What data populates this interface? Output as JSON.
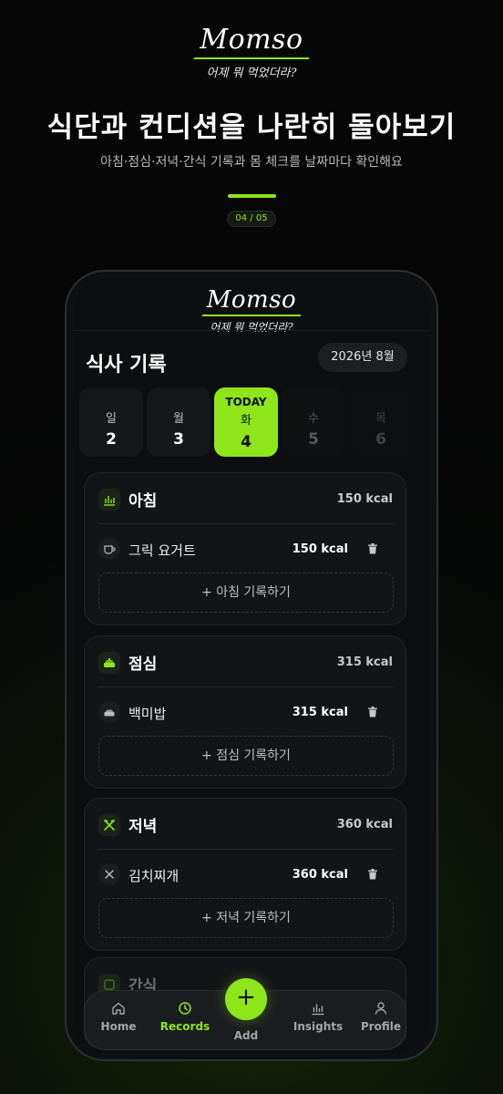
{
  "hero": {
    "logo": "Momso",
    "tagline": "어제 뭐 먹었더라?",
    "headline": "식단과 컨디션을 나란히 돌아보기",
    "subline": "아침·점심·저녁·간식 기록과 몸 체크를 날짜마다 확인해요",
    "page_indicator": "04 / 05"
  },
  "app": {
    "logo": "Momso",
    "tagline": "어제 뭐 먹었더라?",
    "title": "식사 기록",
    "month": "2026년 8월",
    "days": [
      {
        "name": "일",
        "num": "2"
      },
      {
        "name": "월",
        "num": "3"
      },
      {
        "badge": "TODAY",
        "name": "화",
        "num": "4"
      },
      {
        "name": "수",
        "num": "5"
      },
      {
        "name": "목",
        "num": "6"
      }
    ],
    "meals": [
      {
        "name": "아침",
        "total": "150 kcal",
        "food": "그릭 요거트",
        "food_kcal": "150 kcal",
        "add_label": "+ 아침 기록하기"
      },
      {
        "name": "점심",
        "total": "315 kcal",
        "food": "백미밥",
        "food_kcal": "315 kcal",
        "add_label": "+ 점심 기록하기"
      },
      {
        "name": "저녁",
        "total": "360 kcal",
        "food": "김치찌개",
        "food_kcal": "360 kcal",
        "add_label": "+ 저녁 기록하기"
      },
      {
        "name": "간식"
      }
    ],
    "nav": {
      "home": "Home",
      "records": "Records",
      "add": "Add",
      "add_symbol": "+",
      "insights": "Insights",
      "profile": "Profile"
    }
  },
  "colors": {
    "accent": "#8ee61a",
    "background": "#0c0e10",
    "card": "#121518"
  }
}
